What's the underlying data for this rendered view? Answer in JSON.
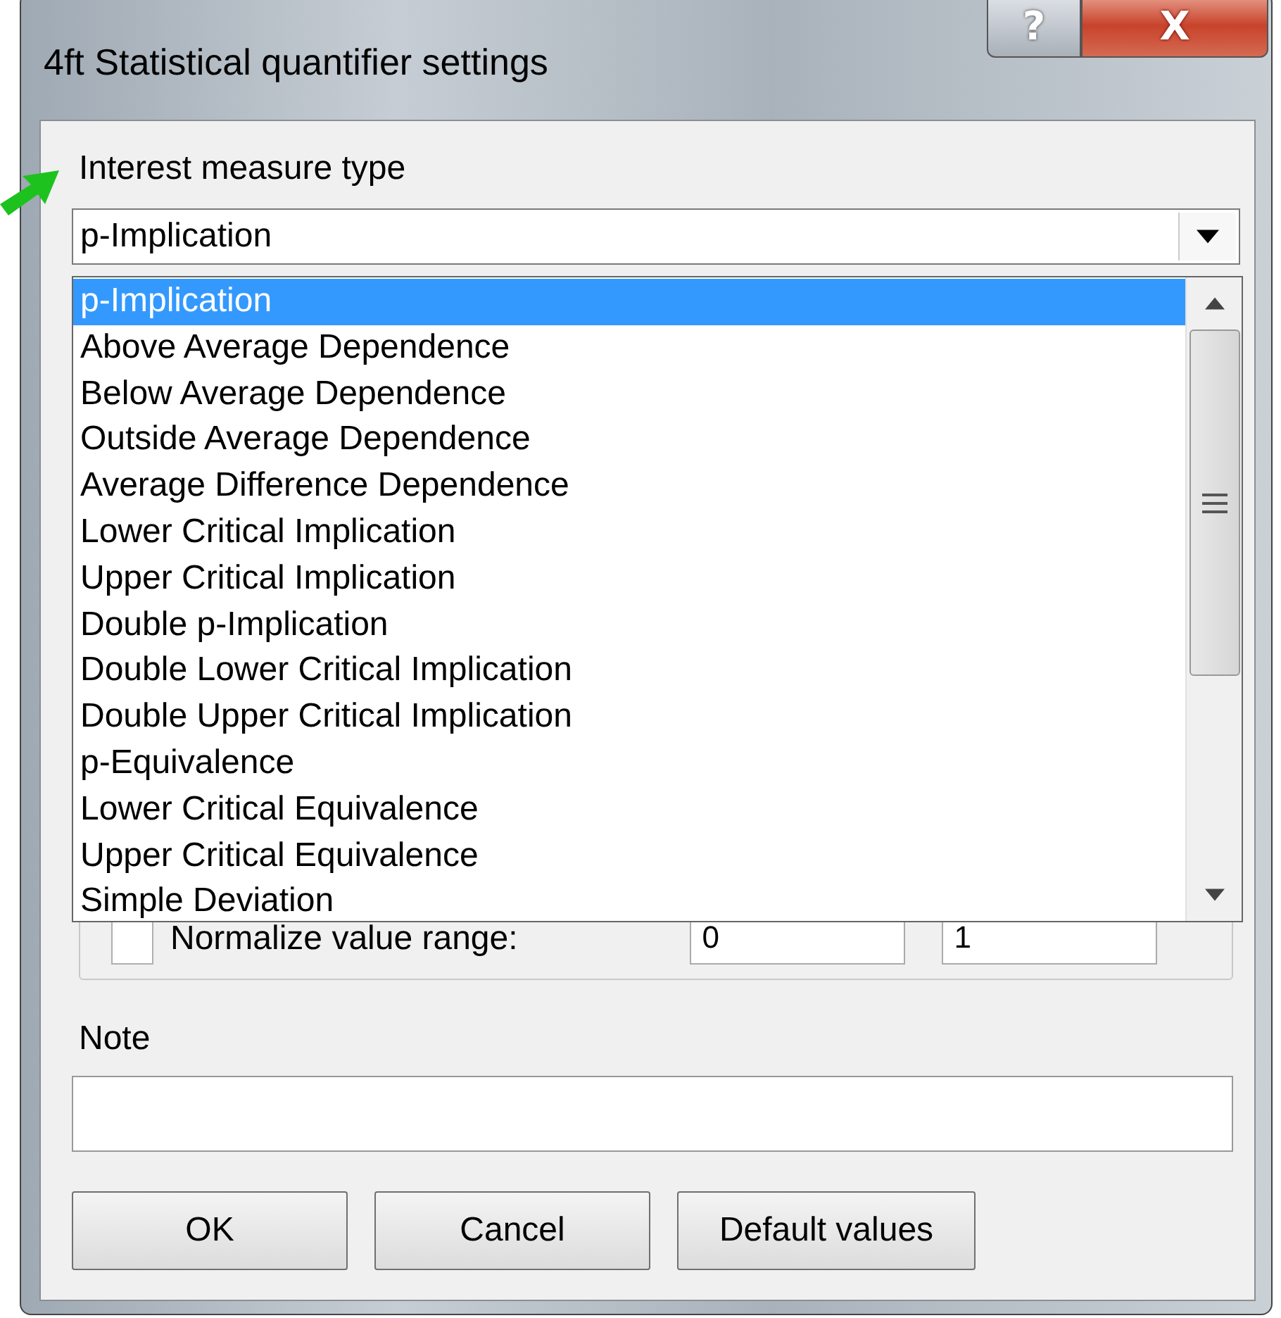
{
  "window": {
    "title": "4ft Statistical quantifier settings",
    "title_buttons": [
      {
        "kind": "help",
        "label": "?"
      },
      {
        "kind": "close",
        "label": "X"
      }
    ]
  },
  "interest_measure": {
    "label": "Interest measure type",
    "value": "p-Implication",
    "expanded": true,
    "options": [
      {
        "label": "p-Implication",
        "selected": true
      },
      {
        "label": "Above Average Dependence",
        "selected": false
      },
      {
        "label": "Below Average Dependence",
        "selected": false
      },
      {
        "label": "Outside Average Dependence",
        "selected": false
      },
      {
        "label": "Average Difference Dependence",
        "selected": false
      },
      {
        "label": "Lower Critical Implication",
        "selected": false
      },
      {
        "label": "Upper Critical Implication",
        "selected": false
      },
      {
        "label": "Double p-Implication",
        "selected": false
      },
      {
        "label": "Double Lower Critical Implication",
        "selected": false
      },
      {
        "label": "Double Upper Critical Implication",
        "selected": false
      },
      {
        "label": "p-Equivalence",
        "selected": false
      },
      {
        "label": "Lower Critical Equivalence",
        "selected": false
      },
      {
        "label": "Upper Critical Equivalence",
        "selected": false
      },
      {
        "label": "Simple Deviation",
        "selected": false
      }
    ]
  },
  "normalize": {
    "label": "Normalize value range:",
    "checked": false,
    "from": "0",
    "to": "1"
  },
  "note": {
    "label": "Note"
  },
  "buttons": [
    {
      "label": "OK"
    },
    {
      "label": "Cancel"
    },
    {
      "label": "Default values"
    }
  ]
}
